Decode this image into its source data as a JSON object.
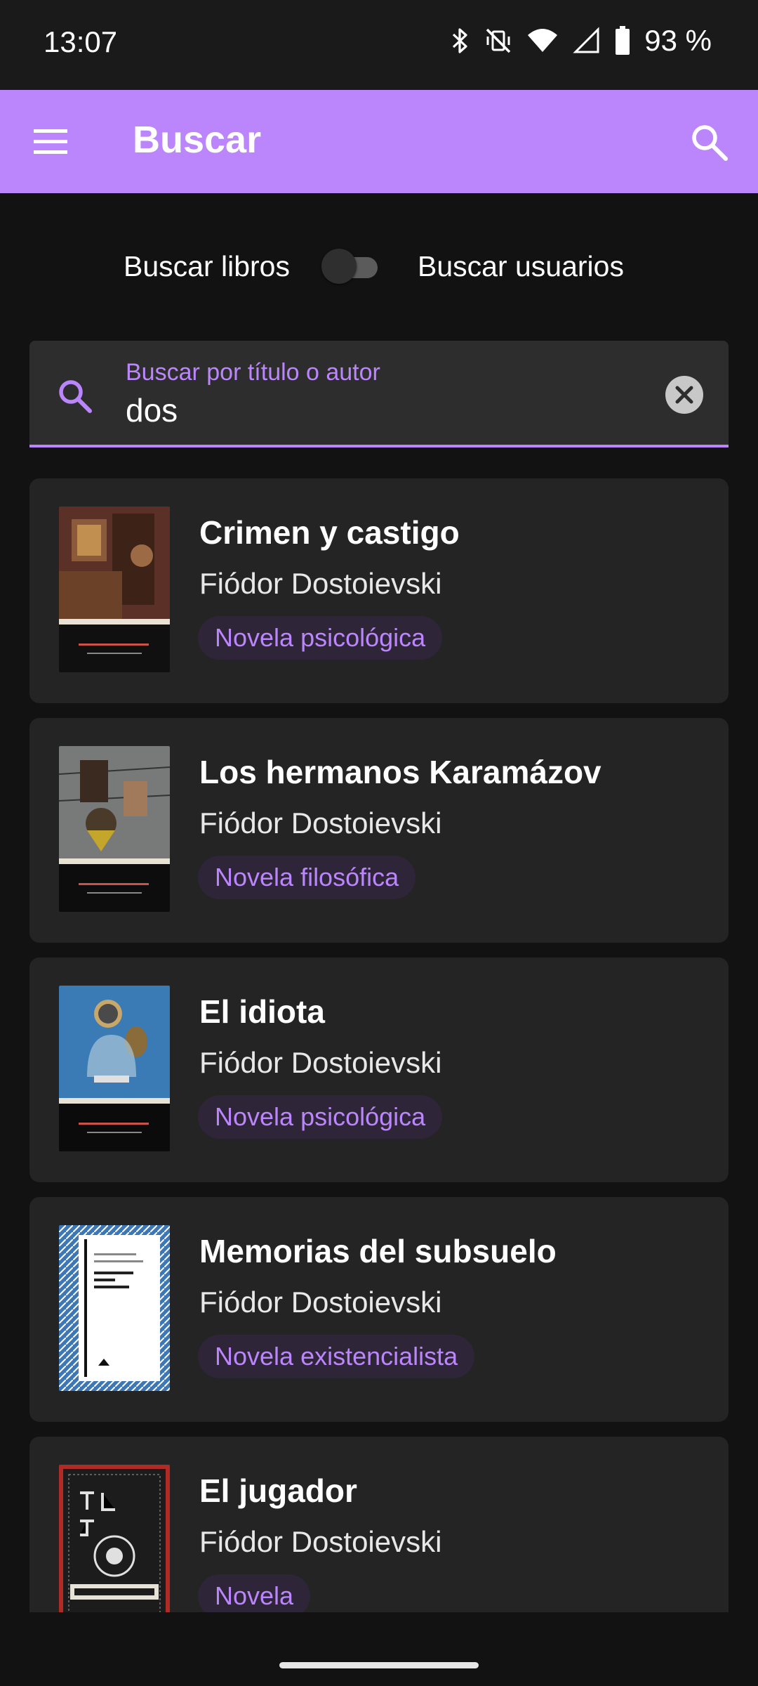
{
  "status_bar": {
    "time": "13:07",
    "battery": "93 %",
    "icons": [
      "bluetooth-icon",
      "vibrate-off-icon",
      "wifi-icon",
      "signal-icon",
      "battery-icon"
    ]
  },
  "app_bar": {
    "title": "Buscar",
    "icons": [
      "menu-icon",
      "search-icon"
    ],
    "color": "#bb86fc"
  },
  "mode_toggle": {
    "left_label": "Buscar libros",
    "right_label": "Buscar usuarios",
    "state": "off"
  },
  "search": {
    "label": "Buscar por título o autor",
    "value": "dos"
  },
  "results": [
    {
      "title": "Crimen y castigo",
      "author": "Fiódor Dostoievski",
      "genre": "Novela psicológica"
    },
    {
      "title": "Los hermanos Karamázov",
      "author": "Fiódor Dostoievski",
      "genre": "Novela filosófica"
    },
    {
      "title": "El idiota",
      "author": "Fiódor Dostoievski",
      "genre": "Novela psicológica"
    },
    {
      "title": "Memorias del subsuelo",
      "author": "Fiódor Dostoievski",
      "genre": "Novela existencialista"
    },
    {
      "title": "El jugador",
      "author": "Fiódor Dostoievski",
      "genre": "Novela"
    }
  ],
  "colors": {
    "background": "#121212",
    "card": "#242424",
    "accent": "#bb86fc"
  }
}
